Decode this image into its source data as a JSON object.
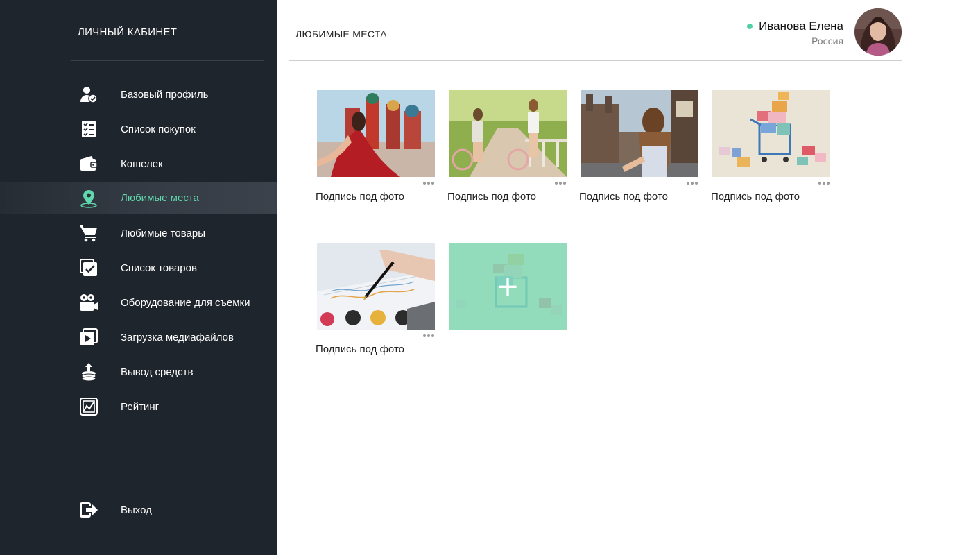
{
  "sidebar": {
    "title": "ЛИЧНЫЙ КАБИНЕТ",
    "items": [
      {
        "label": "Базовый профиль",
        "icon": "user-check-icon"
      },
      {
        "label": "Список покупок",
        "icon": "checklist-icon"
      },
      {
        "label": "Кошелек",
        "icon": "wallet-icon"
      },
      {
        "label": "Любимые места",
        "icon": "map-pin-icon",
        "active": true
      },
      {
        "label": "Любимые товары",
        "icon": "cart-icon"
      },
      {
        "label": "Список товаров",
        "icon": "checked-list-icon"
      },
      {
        "label": "Оборудование для съемки",
        "icon": "video-camera-icon"
      },
      {
        "label": "Загрузка медиафайлов",
        "icon": "media-upload-icon"
      },
      {
        "label": "Вывод средств",
        "icon": "coins-withdraw-icon"
      },
      {
        "label": "Рейтинг",
        "icon": "rating-chart-icon"
      }
    ],
    "logout": {
      "label": "Выход",
      "icon": "logout-icon"
    }
  },
  "header": {
    "page_title": "ЛЮБИМЫЕ МЕСТА",
    "user_name": "Иванова Елена",
    "user_country": "Россия",
    "online": true
  },
  "gallery": {
    "photos": [
      {
        "caption": "Подпись под фото",
        "scene": "woman-red-dress-moscow"
      },
      {
        "caption": "Подпись под фото",
        "scene": "two-women-bicycles"
      },
      {
        "caption": "Подпись под фото",
        "scene": "woman-london-street"
      },
      {
        "caption": "Подпись под фото",
        "scene": "gift-boxes-cart"
      },
      {
        "caption": "Подпись под фото",
        "scene": "hand-pen-charts"
      }
    ],
    "add_label": "+"
  },
  "colors": {
    "sidebar_bg": "#1f252d",
    "accent": "#5fd6ab",
    "online": "#4fd0a7",
    "add_tile": "#8ee0c0"
  }
}
